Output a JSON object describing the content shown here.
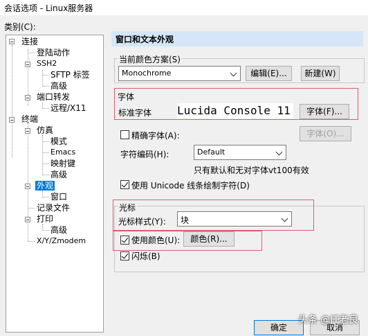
{
  "window": {
    "title": "会话选项 - Linux服务器"
  },
  "sidebar": {
    "label": "类别(C):",
    "items": [
      "连接",
      "登陆动作",
      "SSH2",
      "SFTP 标签",
      "高级",
      "端口转发",
      "远程/X11",
      "终端",
      "仿真",
      "模式",
      "Emacs",
      "映射键",
      "高级",
      "外观",
      "窗口",
      "记录文件",
      "打印",
      "高级",
      "X/Y/Zmodem"
    ],
    "selected": "外观"
  },
  "panel": {
    "title": "窗口和文本外观",
    "scheme": {
      "label": "当前颜色方案(S)",
      "value": "Monochrome",
      "edit_label": "编辑(E)...",
      "new_label": "新建(W)"
    },
    "font": {
      "group_label": "字体",
      "std_label": "标准字体",
      "preview": "Lucida Console 11",
      "button": "字体(F)...",
      "precise_button": "字体(O)...",
      "precise_label": "精确字体(A):"
    },
    "encoding": {
      "label": "字符编码(H):",
      "value": "Default",
      "note": "只有默认和无对字体vt100有效"
    },
    "unicode_label": "使用 Unicode 线条绘制字符(D)",
    "cursor": {
      "group_label": "光标",
      "style_label": "光标样式(Y):",
      "style_value": "块",
      "use_color_label": "使用颜色(U):",
      "color_button": "颜色(R)...",
      "blink_label": "闪烁(B)"
    }
  },
  "footer": {
    "ok": "确定",
    "cancel": "取消"
  },
  "watermark": "头条 @IT老良",
  "colors": {
    "header_bg": "#d4e6f7",
    "highlight": "#e05a6a",
    "selection": "#0078d7"
  }
}
